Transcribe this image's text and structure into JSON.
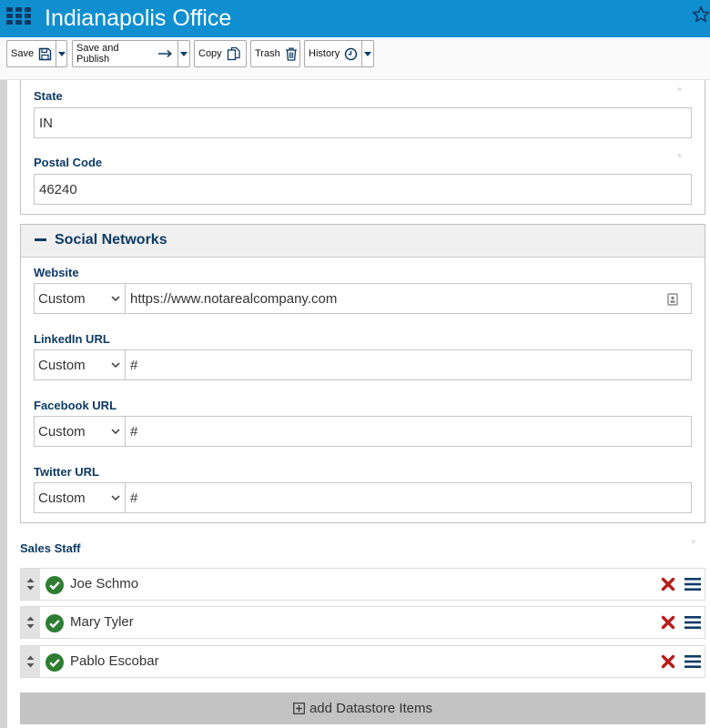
{
  "header": {
    "title": "Indianapolis Office"
  },
  "toolbar": {
    "save_label": "Save",
    "save_publish_label": "Save and Publish",
    "copy_label": "Copy",
    "trash_label": "Trash",
    "history_label": "History"
  },
  "address": {
    "state_label": "State",
    "state_value": "IN",
    "postal_label": "Postal Code",
    "postal_value": "46240",
    "required_mark": "*"
  },
  "social": {
    "section_title": "Social Networks",
    "fields": [
      {
        "label": "Website",
        "select": "Custom",
        "value": "https://www.notarealcompany.com"
      },
      {
        "label": "LinkedIn URL",
        "select": "Custom",
        "value": "#"
      },
      {
        "label": "Facebook URL",
        "select": "Custom",
        "value": "#"
      },
      {
        "label": "Twitter URL",
        "select": "Custom",
        "value": "#"
      }
    ]
  },
  "staff": {
    "label": "Sales Staff",
    "items": [
      {
        "name": "Joe Schmo"
      },
      {
        "name": "Mary Tyler"
      },
      {
        "name": "Pablo Escobar"
      }
    ],
    "add_label": "add Datastore Items"
  },
  "colors": {
    "brand": "#0f8fd0",
    "navy": "#0d3b66",
    "check": "#2e7d32",
    "remove": "#b71c1c"
  }
}
